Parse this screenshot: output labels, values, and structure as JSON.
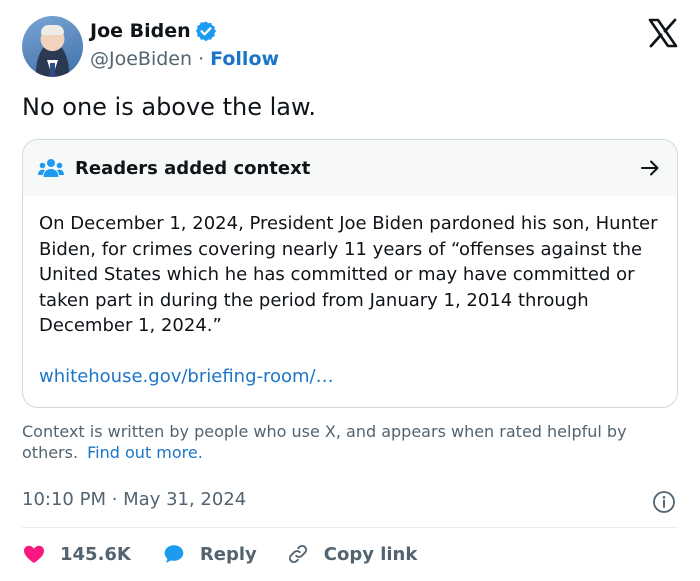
{
  "author": {
    "name": "Joe Biden",
    "handle": "@JoeBiden",
    "separator": " · ",
    "follow_label": "Follow"
  },
  "tweet": {
    "text": "No one is above the law."
  },
  "context_note": {
    "title": "Readers added context",
    "body": "On December 1, 2024, President Joe Biden pardoned his son, Hunter Biden, for crimes covering nearly 11 years of “offenses against the United States which he has committed or may have committed or taken part in during the period from January 1, 2014 through December 1, 2024.”",
    "link": "whitehouse.gov/briefing-room/…",
    "footer": "Context is written by people who use X, and appears when rated helpful by others.",
    "find_out_more": "Find out more."
  },
  "meta": {
    "timestamp": "10:10 PM · May 31, 2024"
  },
  "actions": {
    "likes": "145.6K",
    "reply_label": "Reply",
    "copy_link_label": "Copy link"
  },
  "colors": {
    "link_blue": "#1d75c9",
    "like_pink": "#f91880",
    "reply_blue": "#1d9bf0",
    "muted_gray": "#536471",
    "card_border": "#cfd9de",
    "card_header_bg": "#f7f9f9"
  },
  "icons": [
    "verified-badge-icon",
    "x-logo-icon",
    "readers-icon",
    "arrow-right-icon",
    "info-icon",
    "heart-icon",
    "reply-bubble-icon",
    "link-icon"
  ]
}
